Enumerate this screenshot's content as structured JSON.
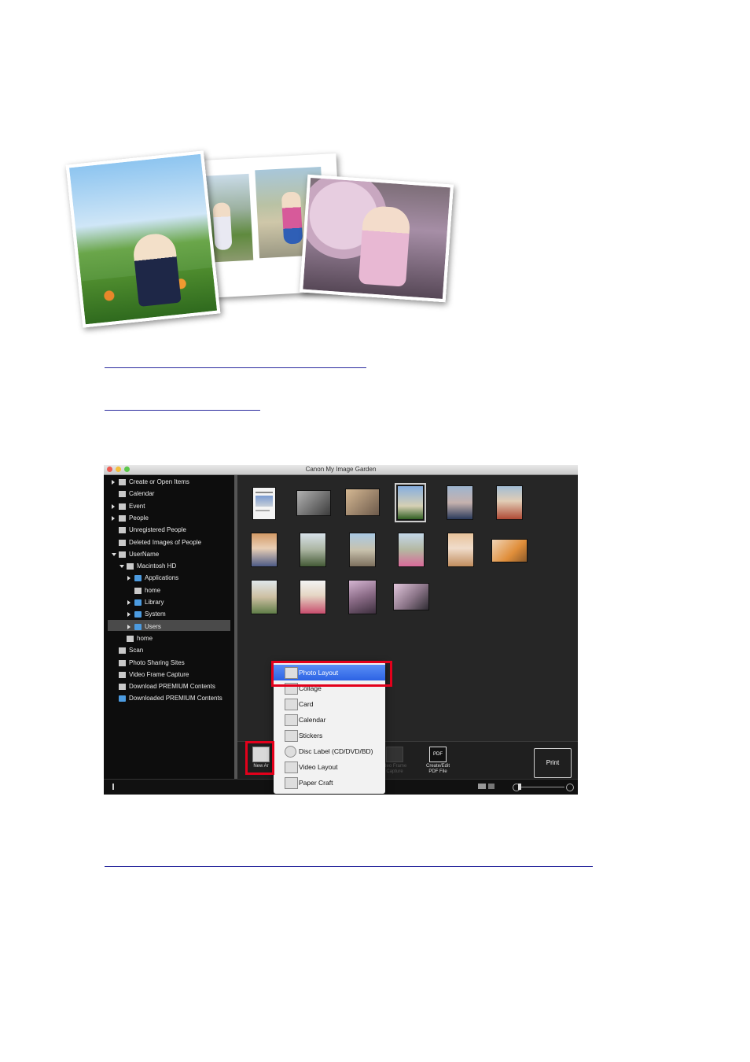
{
  "links": [
    {
      "text": ""
    },
    {
      "text": ""
    },
    {
      "text": ""
    }
  ],
  "window": {
    "title": "Canon My Image Garden",
    "traffic_colors": [
      "#ee5b52",
      "#f5bf3c",
      "#5bc74a"
    ]
  },
  "sidebar": {
    "items": [
      {
        "label": "Create or Open Items",
        "icon": "create-icon",
        "expander": true
      },
      {
        "label": "Calendar",
        "icon": "calendar-icon",
        "expander": false
      },
      {
        "label": "Event",
        "icon": "event-icon",
        "expander": true
      },
      {
        "label": "People",
        "icon": "people-icon",
        "expander": true
      },
      {
        "label": "Unregistered People",
        "icon": "person-icon",
        "expander": false
      },
      {
        "label": "Deleted Images of People",
        "icon": "person-deleted-icon",
        "expander": false
      },
      {
        "label": "UserName",
        "icon": "computer-icon",
        "expander": true,
        "expanded": true
      },
      {
        "label": "Macintosh HD",
        "icon": "hard-drive-icon",
        "expander": true,
        "expanded": true
      },
      {
        "label": "Applications",
        "icon": "folder-icon",
        "expander": true
      },
      {
        "label": "home",
        "icon": "drive-icon",
        "expander": false
      },
      {
        "label": "Library",
        "icon": "folder-icon",
        "expander": true
      },
      {
        "label": "System",
        "icon": "folder-icon",
        "expander": true
      },
      {
        "label": "Users",
        "icon": "folder-icon",
        "expander": true,
        "selected": true
      },
      {
        "label": "home",
        "icon": "drive-icon",
        "expander": false
      },
      {
        "label": "Scan",
        "icon": "scan-icon",
        "expander": false
      },
      {
        "label": "Photo Sharing Sites",
        "icon": "sharing-icon",
        "expander": false
      },
      {
        "label": "Video Frame Capture",
        "icon": "film-icon",
        "expander": false
      },
      {
        "label": "Download PREMIUM Contents",
        "icon": "download-icon",
        "expander": false
      },
      {
        "label": "Downloaded PREMIUM Contents",
        "icon": "folder-icon",
        "expander": false
      }
    ]
  },
  "toolbar": {
    "new_art": "New Ar",
    "video_frame": "ideo Frame\nCapture",
    "create_pdf": "Create/Edit\nPDF File",
    "pdf_badge": "PDF",
    "print": "Print"
  },
  "menu": {
    "items": [
      {
        "label": "Photo Layout",
        "icon": "photo-layout-icon",
        "highlighted": true
      },
      {
        "label": "Collage",
        "icon": "collage-icon"
      },
      {
        "label": "Card",
        "icon": "card-icon"
      },
      {
        "label": "Calendar",
        "icon": "calendar-icon"
      },
      {
        "label": "Stickers",
        "icon": "stickers-icon"
      },
      {
        "label": "Disc Label (CD/DVD/BD)",
        "icon": "disc-icon"
      },
      {
        "label": "Video Layout",
        "icon": "video-layout-icon"
      },
      {
        "label": "Paper Craft",
        "icon": "paper-craft-icon"
      }
    ]
  },
  "colors": {
    "highlight_box": "#e3001b",
    "menu_highlight": "#2c63e4",
    "link": "#2a2a9e"
  }
}
